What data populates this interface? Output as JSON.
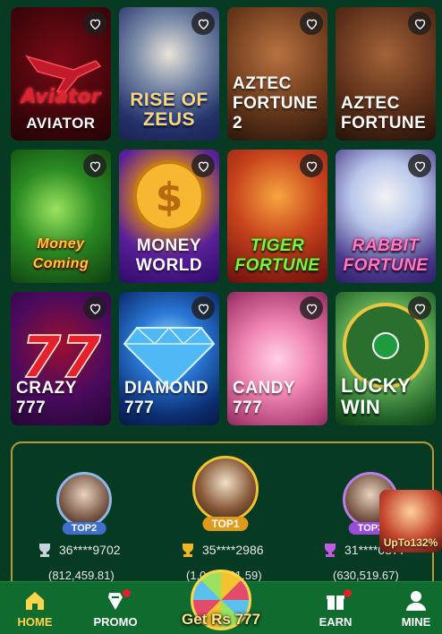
{
  "games": [
    {
      "key": "aviator",
      "title": "AVIATOR",
      "logo": "Aviator"
    },
    {
      "key": "zeus",
      "title": "RISE OF ZEUS"
    },
    {
      "key": "aztec2",
      "title": "AZTEC FORTUNE 2"
    },
    {
      "key": "aztec",
      "title": "AZTEC FORTUNE"
    },
    {
      "key": "money",
      "title": "Money Coming"
    },
    {
      "key": "world",
      "title": "MONEY WORLD"
    },
    {
      "key": "tiger",
      "title": "TIGER FORTUNE"
    },
    {
      "key": "rabbit",
      "title": "RABBIT FORTUNE"
    },
    {
      "key": "crazy",
      "title": "CRAZY 777"
    },
    {
      "key": "diamond",
      "title": "DIAMOND 777"
    },
    {
      "key": "candy",
      "title": "CANDY 777"
    },
    {
      "key": "lucky",
      "title": "LUCKY WIN"
    }
  ],
  "leaderboard": {
    "top1": {
      "badge": "TOP1",
      "user": "35****2986",
      "amount": "(1,046,101.59)"
    },
    "top2": {
      "badge": "TOP2",
      "user": "36****9702",
      "amount": "(812,459.81)"
    },
    "top3": {
      "badge": "TOP3",
      "user": "31****0877",
      "amount": "(630,519.67)"
    }
  },
  "promo_float": {
    "text": "UpTo132%"
  },
  "nav": {
    "home": "HOME",
    "promo": "PROMO",
    "get": "Get Rs 777",
    "earn": "EARN",
    "mine": "MINE"
  },
  "colors": {
    "accent": "#ffd54a",
    "nav_bg": "#0f6b2e",
    "page_bg": "#063a22"
  }
}
